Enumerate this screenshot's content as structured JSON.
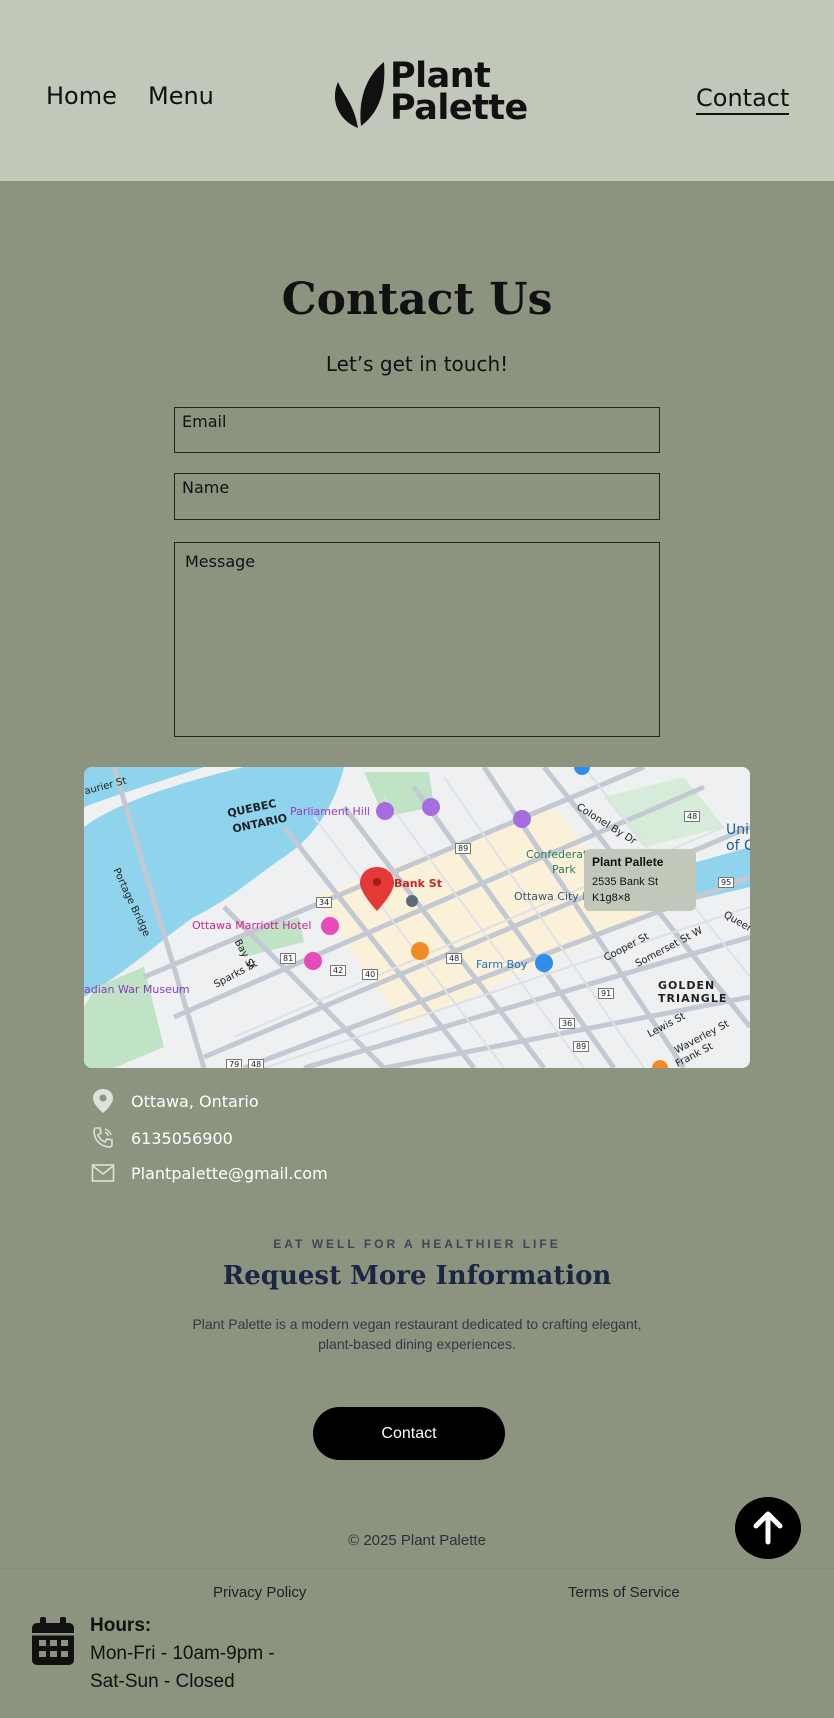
{
  "header": {
    "nav": {
      "home": "Home",
      "menu": "Menu",
      "contact": "Contact"
    },
    "logo": {
      "line1": "Plant",
      "line2": "Palette"
    }
  },
  "contact_form": {
    "title": "Contact Us",
    "subtitle": "Let’s get in touch!",
    "email_placeholder": "Email",
    "name_placeholder": "Name",
    "message_placeholder": "Message"
  },
  "map": {
    "pin_label": "Bank St",
    "card": {
      "name": "Plant Pallete",
      "address_line1": "2535 Bank St",
      "address_line2": "K1g8×8"
    },
    "labels": {
      "quebec": "QUEBEC",
      "ontario": "ONTARIO",
      "parliament": "Parliament Hill",
      "marriott": "Ottawa Marriott Hotel",
      "war_museum": "adian War Museum",
      "confederation": "Confederati",
      "park": "Park",
      "city_hall": "Ottawa City H",
      "farm_boy": "Farm Boy",
      "golden": "GOLDEN",
      "triangle": "TRIANGLE",
      "colonel_by": "Colonel By Dr",
      "portage": "Portage Bridge",
      "laurier": "aurier St",
      "sparks": "Sparks St",
      "bay": "Bay St",
      "cooper": "Cooper St",
      "somerset": "Somerset St W",
      "lewis": "Lewis St",
      "waverley": "Waverley St",
      "frank": "Frank St",
      "queen": "Queen",
      "uni": "Uni",
      "of_c": "of C",
      "r_81": "81",
      "r_34": "34",
      "r_42": "42",
      "r_40": "40",
      "r_48a": "48",
      "r_48b": "48",
      "r_89a": "89",
      "r_89b": "89",
      "r_36": "36",
      "r_91": "91",
      "r_95": "95",
      "r_48c": "48",
      "r_79": "79"
    }
  },
  "contact_info": {
    "location": "Ottawa, Ontario",
    "phone": "6135056900",
    "email": "Plantpalette@gmail.com"
  },
  "request": {
    "eyebrow": "EAT WELL FOR A HEALTHIER LIFE",
    "title": "Request More Information",
    "description": "Plant Palette is a modern vegan restaurant dedicated to crafting elegant, plant-based dining experiences.",
    "button": "Contact"
  },
  "footer": {
    "copyright": "© 2025 Plant Palette",
    "privacy": "Privacy Policy",
    "terms": "Terms of Service",
    "hours_title": "Hours:",
    "hours_weekday": "Mon-Fri - 10am-9pm -",
    "hours_weekend": "Sat-Sun - Closed"
  },
  "colors": {
    "page_bg": "#8c937f",
    "header_bg": "#c2c8b9",
    "heading_navy": "#1b2545",
    "water": "#8fd3ec",
    "park_green": "#bfe3c4"
  }
}
